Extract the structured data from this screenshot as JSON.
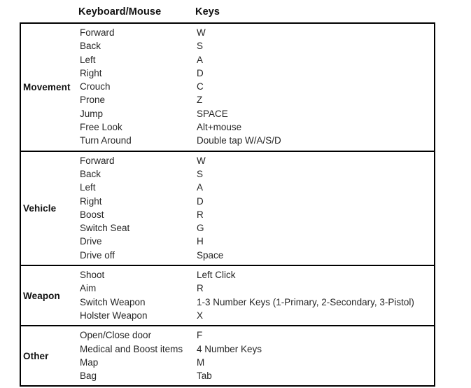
{
  "header": {
    "section_col": "",
    "action_col": "Keyboard/Mouse",
    "keys_col": "Keys"
  },
  "sections": [
    {
      "label": "Movement",
      "rows": [
        {
          "action": "Forward",
          "keys": "W"
        },
        {
          "action": "Back",
          "keys": "S"
        },
        {
          "action": "Left",
          "keys": "A"
        },
        {
          "action": "Right",
          "keys": "D"
        },
        {
          "action": "Crouch",
          "keys": "C"
        },
        {
          "action": "Prone",
          "keys": "Z"
        },
        {
          "action": "Jump",
          "keys": "SPACE"
        },
        {
          "action": "Free Look",
          "keys": "Alt+mouse"
        },
        {
          "action": "Turn Around",
          "keys": "Double tap W/A/S/D"
        }
      ]
    },
    {
      "label": "Vehicle",
      "rows": [
        {
          "action": "Forward",
          "keys": "W"
        },
        {
          "action": "Back",
          "keys": "S"
        },
        {
          "action": "Left",
          "keys": "A"
        },
        {
          "action": "Right",
          "keys": "D"
        },
        {
          "action": "Boost",
          "keys": "R"
        },
        {
          "action": "Switch Seat",
          "keys": "G"
        },
        {
          "action": "Drive",
          "keys": "H"
        },
        {
          "action": "Drive off",
          "keys": "Space"
        }
      ]
    },
    {
      "label": "Weapon",
      "rows": [
        {
          "action": "Shoot",
          "keys": "Left Click"
        },
        {
          "action": "Aim",
          "keys": "R"
        },
        {
          "action": "Switch Weapon",
          "keys": "1-3 Number Keys (1-Primary, 2-Secondary, 3-Pistol)"
        },
        {
          "action": "Holster Weapon",
          "keys": "X"
        }
      ]
    },
    {
      "label": "Other",
      "rows": [
        {
          "action": "Open/Close door",
          "keys": "F"
        },
        {
          "action": "Medical and Boost items",
          "keys": "4 Number Keys"
        },
        {
          "action": "Map",
          "keys": "M"
        },
        {
          "action": "Bag",
          "keys": "Tab"
        }
      ]
    }
  ],
  "colors": {
    "border": "#000000",
    "text": "#262626",
    "heading": "#111111",
    "background": "#ffffff"
  }
}
